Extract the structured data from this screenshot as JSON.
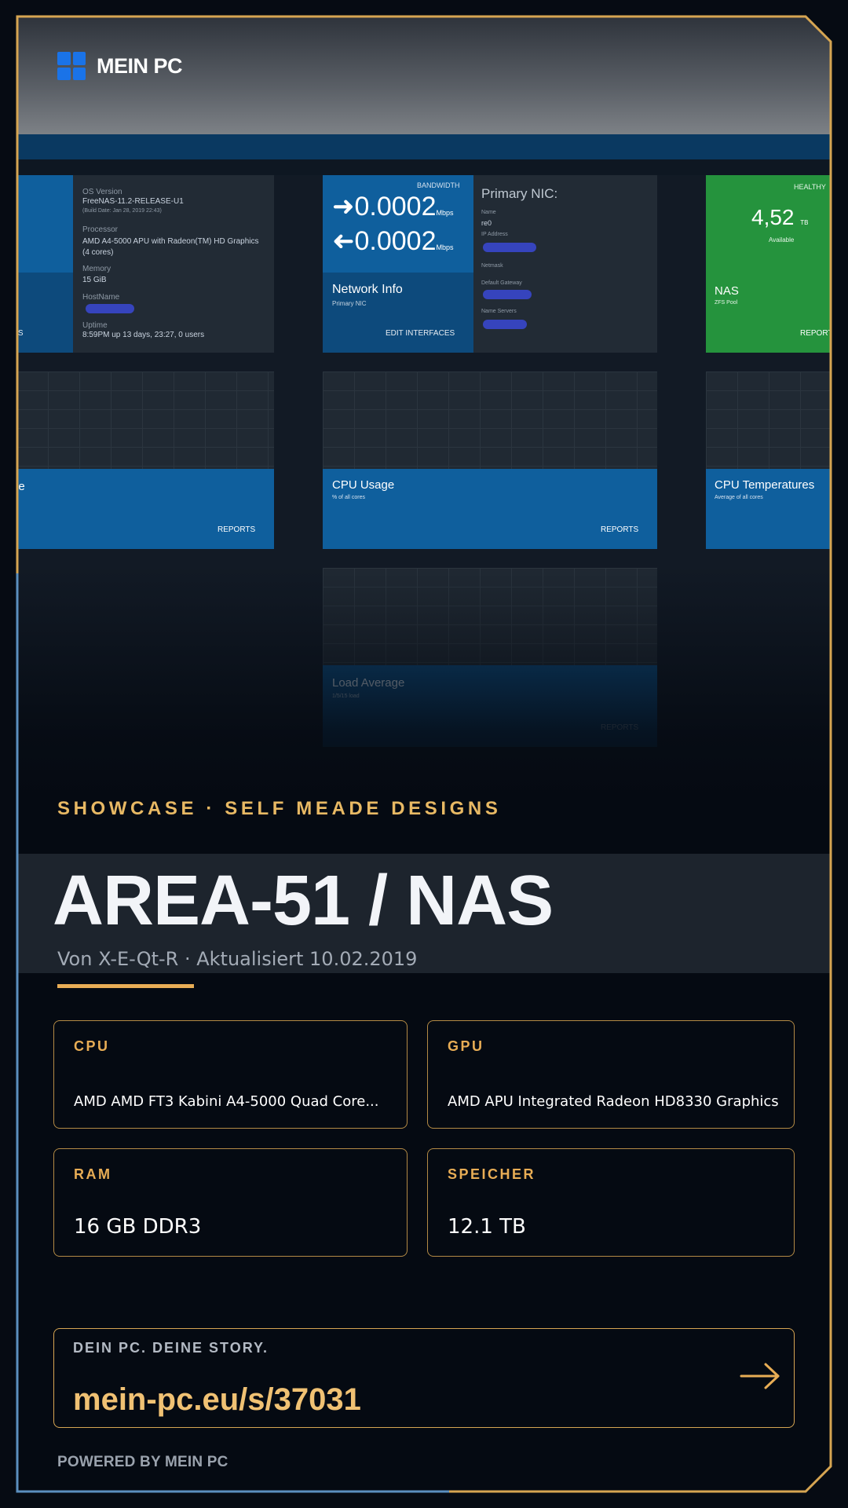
{
  "brand": {
    "name": "MEIN PC",
    "logo_icon": "windows-logo-icon",
    "logo_color": "#1a73e8"
  },
  "dashboard": {
    "system_panel": {
      "os_label": "OS Version",
      "os_value": "FreeNAS-11.2-RELEASE-U1",
      "build_date": "(Build Date: Jan 28, 2019 22:43)",
      "processor_label": "Processor",
      "processor_value": "AMD A4-5000 APU with Radeon(TM) HD Graphics",
      "cores": "(4 cores)",
      "memory_label": "Memory",
      "memory_value": "15 GiB",
      "hostname_label": "HostName",
      "uptime_label": "Uptime",
      "uptime_value": "8:59PM up 13 days, 23:27, 0 users",
      "action": "UPDATES"
    },
    "network_panel": {
      "bandwidth_label": "BANDWIDTH",
      "in_value": "0.0002",
      "out_value": "0.0002",
      "unit": "Mbps",
      "title": "Network Info",
      "subtitle": "Primary NIC",
      "action": "EDIT INTERFACES",
      "nic_heading": "Primary NIC:",
      "name_label": "Name",
      "name_value": "re0",
      "ip_label": "IP Address",
      "netmask_label": "Netmask",
      "gateway_label": "Default Gateway",
      "dns_label": "Name Servers"
    },
    "pool_panel": {
      "status": "HEALTHY",
      "value": "4,52",
      "unit": "TB",
      "available": "Available",
      "title": "NAS",
      "subtitle": "ZFS Pool",
      "action": "REPORTS"
    },
    "cpu_usage": {
      "title": "CPU Usage",
      "subtitle": "% of all cores",
      "action": "REPORTS"
    },
    "left_chart": {
      "title": "ge",
      "action": "REPORTS"
    },
    "cpu_temp": {
      "title": "CPU Temperatures",
      "subtitle": "Average of all cores"
    },
    "load_average": {
      "title": "Load Average",
      "subtitle": "1/5/15 load",
      "action": "REPORTS"
    }
  },
  "hero": {
    "eyebrow": "SHOWCASE · SELF MEADE DESIGNS",
    "title": "AREA-51 / NAS",
    "subtitle": "Von X-E-Qt-R · Aktualisiert 10.02.2019"
  },
  "specs": {
    "cpu": {
      "label": "CPU",
      "value": "AMD AMD FT3 Kabini A4-5000 Quad Core..."
    },
    "gpu": {
      "label": "GPU",
      "value": "AMD APU Integrated Radeon HD8330 Graphics"
    },
    "ram": {
      "label": "RAM",
      "value": "16 GB DDR3"
    },
    "storage": {
      "label": "SPEICHER",
      "value": "12.1 TB"
    }
  },
  "cta": {
    "label": "DEIN PC. DEINE STORY.",
    "url": "mein-pc.eu/s/37031",
    "arrow_icon": "arrow-right-icon"
  },
  "footer": {
    "powered": "POWERED BY MEIN PC"
  },
  "colors": {
    "accent": "#e8ad55",
    "frame_gold": "#d6a552",
    "frame_blue": "#5b8fbf",
    "background": "#050a12"
  }
}
